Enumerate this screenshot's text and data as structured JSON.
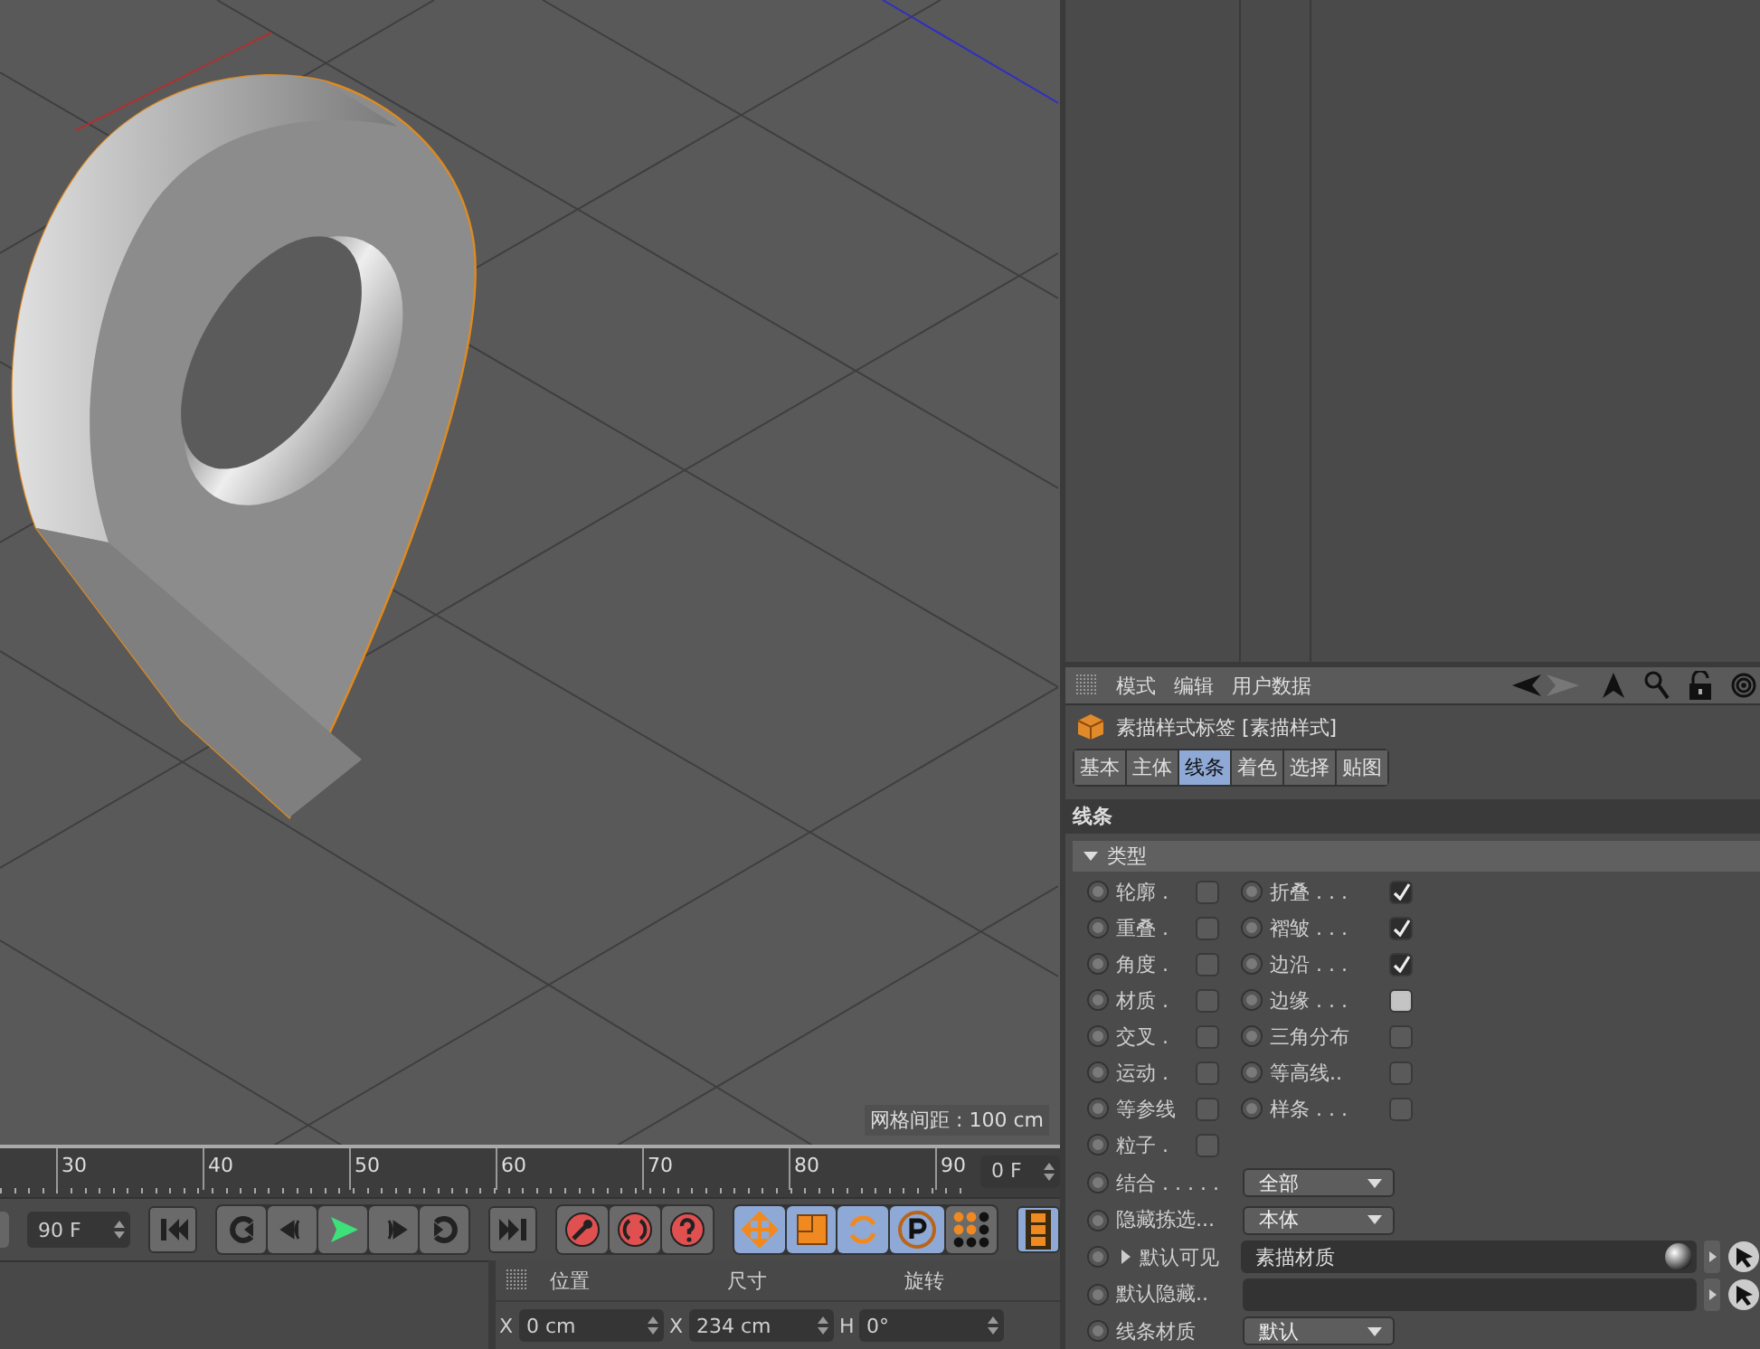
{
  "viewport": {
    "grid_label": "网格间距 : 100 cm"
  },
  "timeline": {
    "ticks": [
      "30",
      "40",
      "50",
      "60",
      "70",
      "80",
      "90"
    ],
    "current_frame": "0 F"
  },
  "transport": {
    "end_frame": "90 F"
  },
  "tools": [
    {
      "kind": "move",
      "selected": true
    },
    {
      "kind": "scale",
      "selected": true
    },
    {
      "kind": "rotate",
      "selected": true
    },
    {
      "kind": "point",
      "selected": true
    },
    {
      "kind": "dots",
      "selected": false
    }
  ],
  "film_button": {
    "selected": true
  },
  "coordinates": {
    "headers": [
      "位置",
      "尺寸",
      "旋转"
    ],
    "fields": [
      {
        "axis": "X",
        "value": "0 cm"
      },
      {
        "axis": "X",
        "value": "234 cm"
      },
      {
        "axis": "H",
        "value": "0°"
      }
    ]
  },
  "attributes": {
    "menu": [
      "模式",
      "编辑",
      "用户数据"
    ],
    "title": "素描样式标签 [素描样式]",
    "tabs": [
      {
        "label": "基本",
        "selected": false
      },
      {
        "label": "主体",
        "selected": false
      },
      {
        "label": "线条",
        "selected": true
      },
      {
        "label": "着色",
        "selected": false
      },
      {
        "label": "选择",
        "selected": false
      },
      {
        "label": "贴图",
        "selected": false
      }
    ],
    "section": "线条",
    "group": "类型",
    "checks_left": [
      {
        "label": "轮廓 .",
        "checked": false
      },
      {
        "label": "重叠 .",
        "checked": false
      },
      {
        "label": "角度 .",
        "checked": false
      },
      {
        "label": "材质 .",
        "checked": false
      },
      {
        "label": "交叉 .",
        "checked": false
      },
      {
        "label": "运动 .",
        "checked": false
      },
      {
        "label": "等参线",
        "checked": false
      },
      {
        "label": "粒子 .",
        "checked": false
      }
    ],
    "checks_right": [
      {
        "label": "折叠 . . .",
        "checked": true,
        "focused": false
      },
      {
        "label": "褶皱 . . .",
        "checked": true,
        "focused": false
      },
      {
        "label": "边沿 . . .",
        "checked": true,
        "focused": false
      },
      {
        "label": "边缘 . . .",
        "checked": false,
        "focused": true
      },
      {
        "label": "三角分布",
        "checked": false,
        "focused": false
      },
      {
        "label": "等高线..",
        "checked": false,
        "focused": false
      },
      {
        "label": "样条 . . .",
        "checked": false,
        "focused": false
      }
    ],
    "rows": [
      {
        "kind": "dropdown",
        "label": "结合 . . . . .",
        "value": "全部"
      },
      {
        "kind": "dropdown",
        "label": "隐藏拣选...",
        "value": "本体"
      },
      {
        "kind": "link",
        "label": "默认可见",
        "expander": true,
        "value": "素描材质"
      },
      {
        "kind": "link",
        "label": "默认隐藏..",
        "expander": false
      },
      {
        "kind": "dropdown",
        "label": "线条材质",
        "value": "默认"
      }
    ]
  }
}
